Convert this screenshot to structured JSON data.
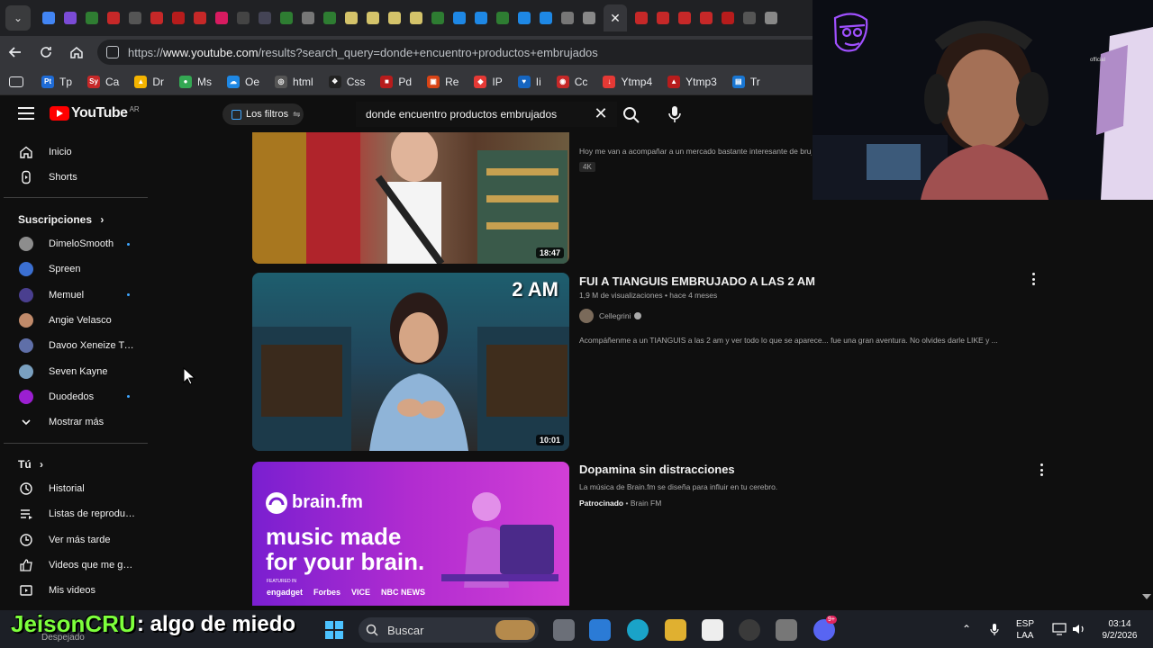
{
  "browser": {
    "url_prefix": "https://",
    "url_host": "www.youtube.com",
    "url_path": "/results?search_query=donde+encuentro+productos+embrujados",
    "close_tab": "✕",
    "bookmarks": [
      {
        "label": "Tp",
        "icon": "Pt",
        "color": "#1e6bd6"
      },
      {
        "label": "Ca",
        "icon": "Sy",
        "color": "#c62828"
      },
      {
        "label": "Dr",
        "icon": "▲",
        "color": "#f4b400"
      },
      {
        "label": "Ms",
        "icon": "●",
        "color": "#34a853"
      },
      {
        "label": "Oe",
        "icon": "☁",
        "color": "#1e88e5"
      },
      {
        "label": "html",
        "icon": "◎",
        "color": "#555"
      },
      {
        "label": "Css",
        "icon": "❖",
        "color": "#222"
      },
      {
        "label": "Pd",
        "icon": "■",
        "color": "#b71c1c"
      },
      {
        "label": "Re",
        "icon": "▣",
        "color": "#d84315"
      },
      {
        "label": "IP",
        "icon": "◆",
        "color": "#e53935"
      },
      {
        "label": "Ii",
        "icon": "♥",
        "color": "#1565c0"
      },
      {
        "label": "Cc",
        "icon": "◉",
        "color": "#c62828"
      },
      {
        "label": "Ytmp4",
        "icon": "↓",
        "color": "#e53935"
      },
      {
        "label": "Ytmp3",
        "icon": "▲",
        "color": "#b71c1c"
      },
      {
        "label": "Tr",
        "icon": "▤",
        "color": "#1976d2"
      }
    ]
  },
  "header": {
    "logo_text": "YouTube",
    "country_code": "AR",
    "filters_label": "Los filtros",
    "search_value": "donde encuentro productos embrujados"
  },
  "sidebar": {
    "main": [
      {
        "label": "Inicio",
        "icon": "home-icon"
      },
      {
        "label": "Shorts",
        "icon": "shorts-icon"
      }
    ],
    "subscriptions_title": "Suscripciones",
    "subscriptions": [
      {
        "label": "DimeloSmooth",
        "color": "#8d8d8d",
        "dot": true
      },
      {
        "label": "Spreen",
        "color": "#3b6fd1",
        "dot": false
      },
      {
        "label": "Memuel",
        "color": "#4a3f8f",
        "dot": true
      },
      {
        "label": "Angie Velasco",
        "color": "#c08a6a",
        "dot": false
      },
      {
        "label": "Davoo Xeneize Twit...",
        "color": "#5f6fa8",
        "dot": false
      },
      {
        "label": "Seven Kayne",
        "color": "#7aa0c0",
        "dot": false
      },
      {
        "label": "Duodedos",
        "color": "#9b1fd1",
        "dot": true
      }
    ],
    "show_more": "Mostrar más",
    "you_title": "Tú",
    "you_items": [
      {
        "label": "Historial",
        "icon": "history-icon"
      },
      {
        "label": "Listas de reproduc...",
        "icon": "playlists-icon"
      },
      {
        "label": "Ver más tarde",
        "icon": "watch-later-icon"
      },
      {
        "label": "Videos que me gus...",
        "icon": "like-icon"
      },
      {
        "label": "Mis videos",
        "icon": "my-videos-icon"
      }
    ]
  },
  "results": [
    {
      "desc": "Hoy me van a acompañar a un mercado bastante interesante de brujería",
      "badge": "4K",
      "duration": "18:47"
    },
    {
      "title": "FUI A TIANGUIS EMBRUJADO A LAS 2 AM",
      "meta": "1,9 M de visualizaciones • hace 4 meses",
      "channel": "Cellegrini",
      "desc": "Acompáñenme a un TIANGUIS a las 2 am y ver todo lo que se aparece... fue una gran aventura. No olvides darle LIKE y ...",
      "duration": "10:01",
      "thumb_text": "2 AM"
    },
    {
      "title": "Dopamina sin distracciones",
      "meta": "La música de Brain.fm se diseña para influir en tu cerebro.",
      "sponsored": "Patrocinado",
      "sponsor_name": "• Brain FM",
      "ad_brand": "brain.fm",
      "ad_line1": "music made",
      "ad_line2": "for your brain.",
      "ad_featured": "FEATURED IN",
      "ad_press": [
        "engadget",
        "Forbes",
        "VICE",
        "NBC NEWS"
      ]
    }
  ],
  "webcam": {
    "label": "official"
  },
  "overlay": {
    "name": "JeisonCRU",
    "message": ": algo de miedo",
    "weather": "Despejado"
  },
  "taskbar": {
    "search_placeholder": "Buscar",
    "lang_line1": "ESP",
    "lang_line2": "LAA",
    "time": "03:14",
    "date": "9/2/2026",
    "notif_badge": "9+"
  }
}
